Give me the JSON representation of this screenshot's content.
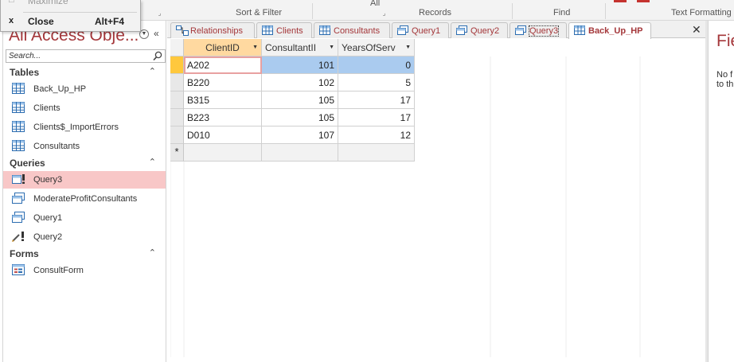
{
  "system_menu": {
    "items": [
      {
        "glyph": "□",
        "label": "Maximize",
        "shortcut": ""
      },
      {
        "glyph": "x",
        "label": "Close",
        "shortcut": "Alt+F4"
      }
    ]
  },
  "ribbon": {
    "groups": [
      "Sort & Filter",
      "Records",
      "Find",
      "Text Formatting"
    ],
    "partial_label": "All"
  },
  "navigation_pane": {
    "title": "All Access Obje...",
    "search_placeholder": "Search...",
    "sections": [
      {
        "name": "Tables",
        "items": [
          "Back_Up_HP",
          "Clients",
          "Clients$_ImportErrors",
          "Consultants"
        ]
      },
      {
        "name": "Queries",
        "items": [
          "Query3",
          "ModerateProfitConsultants",
          "Query1",
          "Query2"
        ]
      },
      {
        "name": "Forms",
        "items": [
          "ConsultForm"
        ]
      }
    ],
    "selected_item": "Query3"
  },
  "document_tabs": [
    {
      "label": "Relationships",
      "icon": "relationships-icon"
    },
    {
      "label": "Clients",
      "icon": "table-icon"
    },
    {
      "label": "Consultants",
      "icon": "table-icon"
    },
    {
      "label": "Query1",
      "icon": "query-icon"
    },
    {
      "label": "Query2",
      "icon": "query-icon"
    },
    {
      "label": "Query3",
      "icon": "query-icon"
    },
    {
      "label": "Back_Up_HP",
      "icon": "table-icon"
    }
  ],
  "active_tab": "Back_Up_HP",
  "datasheet": {
    "columns": [
      "ClientID",
      "ConsultantII",
      "YearsOfServ"
    ],
    "rows": [
      [
        "A202",
        "101",
        "0"
      ],
      [
        "B220",
        "102",
        "5"
      ],
      [
        "B315",
        "105",
        "17"
      ],
      [
        "B223",
        "105",
        "17"
      ],
      [
        "D010",
        "107",
        "12"
      ]
    ],
    "new_record_marker": "*"
  },
  "field_list": {
    "title": "Fie",
    "message_lines": [
      "No f",
      "to th"
    ]
  },
  "colors": {
    "accent": "#a4373a",
    "selected_item_bg": "#f8c7c7",
    "key_header": "#ffd9a0",
    "cell_highlight": "#aacbef",
    "current_record": "#ffc83d"
  }
}
